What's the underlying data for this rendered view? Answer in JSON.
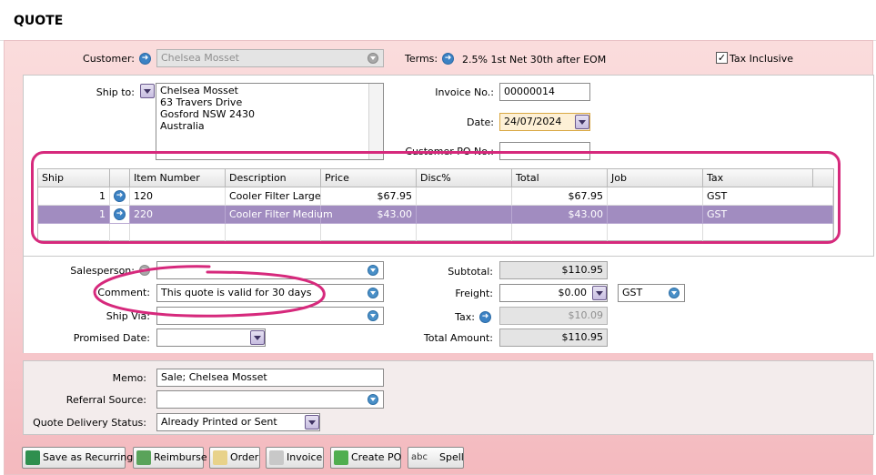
{
  "window": {
    "title": "QUOTE"
  },
  "header": {
    "customer_label": "Customer:",
    "customer_value": "Chelsea Mosset",
    "terms_label": "Terms:",
    "terms_value": "2.5% 1st Net 30th after EOM",
    "tax_inclusive_label": "Tax Inclusive",
    "tax_inclusive_checked": true
  },
  "shipping": {
    "ship_to_label": "Ship to:",
    "address_lines": [
      "Chelsea Mosset",
      "63 Travers Drive",
      "Gosford  NSW  2430",
      "Australia"
    ]
  },
  "invoice": {
    "invoice_no_label": "Invoice No.:",
    "invoice_no_value": "00000014",
    "date_label": "Date:",
    "date_value": "24/07/2024",
    "customer_po_label": "Customer PO No.:",
    "customer_po_value": ""
  },
  "grid": {
    "columns": [
      "Ship",
      "",
      "Item Number",
      "Description",
      "Price",
      "Disc%",
      "Total",
      "Job",
      "Tax"
    ],
    "rows": [
      {
        "ship": "1",
        "item_number": "120",
        "description": "Cooler Filter Large",
        "price": "$67.95",
        "disc": "",
        "total": "$67.95",
        "job": "",
        "tax": "GST",
        "selected": false
      },
      {
        "ship": "1",
        "item_number": "220",
        "description": "Cooler Filter Medium",
        "price": "$43.00",
        "disc": "",
        "total": "$43.00",
        "job": "",
        "tax": "GST",
        "selected": true
      }
    ]
  },
  "details": {
    "salesperson_label": "Salesperson:",
    "salesperson_value": "",
    "comment_label": "Comment:",
    "comment_value": "This quote is valid for 30 days",
    "ship_via_label": "Ship Via:",
    "ship_via_value": "",
    "promised_date_label": "Promised Date:",
    "promised_date_value": ""
  },
  "totals": {
    "subtotal_label": "Subtotal:",
    "subtotal_value": "$110.95",
    "freight_label": "Freight:",
    "freight_value": "$0.00",
    "freight_tax_code": "GST",
    "tax_label": "Tax:",
    "tax_value": "$10.09",
    "total_amount_label": "Total Amount:",
    "total_amount_value": "$110.95"
  },
  "footer_fields": {
    "memo_label": "Memo:",
    "memo_value": "Sale; Chelsea Mosset",
    "referral_label": "Referral Source:",
    "referral_value": "",
    "delivery_status_label": "Quote Delivery Status:",
    "delivery_status_value": "Already Printed or Sent"
  },
  "buttons": {
    "save_recurring": "Save as Recurring",
    "reimburse": "Reimburse",
    "order": "Order",
    "invoice": "Invoice",
    "create_po": "Create PO",
    "spell": "Spell"
  },
  "colors": {
    "highlight": "#d6297c",
    "selected_row": "#a18cc0",
    "background": "#f7cfd2"
  }
}
